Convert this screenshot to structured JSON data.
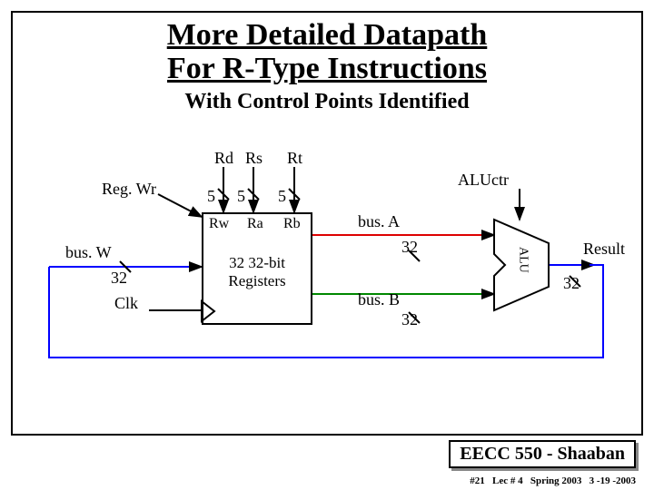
{
  "title_line1": "More Detailed Datapath",
  "title_line2": "For R-Type Instructions",
  "subtitle": "With Control Points Identified",
  "labels": {
    "regwr": "Reg. Wr",
    "rd": "Rd",
    "rs": "Rs",
    "rt": "Rt",
    "width5a": "5",
    "width5b": "5",
    "width5c": "5",
    "rw": "Rw",
    "ra": "Ra",
    "rb": "Rb",
    "busw": "bus. W",
    "w32": "32",
    "clk": "Clk",
    "regfile1": "32 32-bit",
    "regfile2": "Registers",
    "busA": "bus. A",
    "busB": "bus. B",
    "a32": "32",
    "b32": "32",
    "r32": "32",
    "aluctr": "ALUctr",
    "alu": "ALU",
    "result": "Result"
  },
  "footer": {
    "course": "EECC 550 - Shaaban",
    "page": "#21",
    "lec": "Lec # 4",
    "term": "Spring 2003",
    "date": "3 -19 -2003"
  }
}
